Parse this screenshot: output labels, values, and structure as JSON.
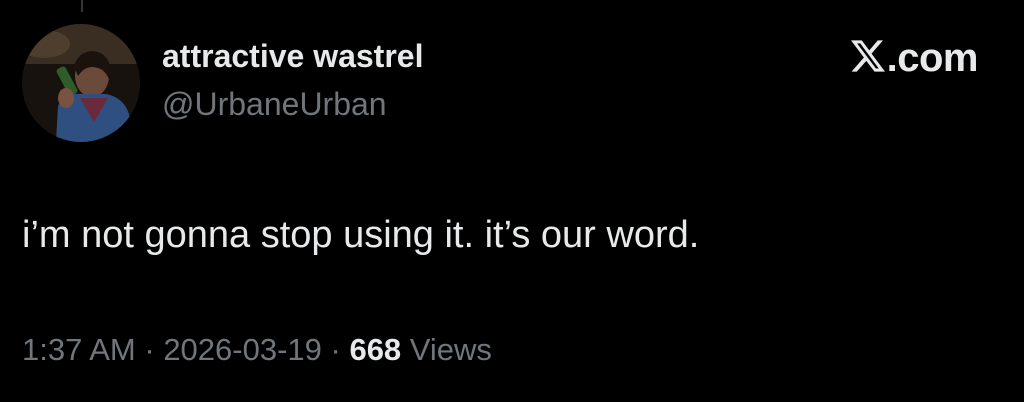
{
  "author": {
    "display_name": "attractive wastrel",
    "handle": "@UrbaneUrban",
    "avatar": "profile-photo"
  },
  "brand": {
    "icon": "x-logo-icon",
    "text": ".com"
  },
  "tweet": {
    "text": "i’m not gonna stop using it. it’s our word."
  },
  "meta": {
    "time": "1:37 AM",
    "separator": " · ",
    "date": "2026-03-19",
    "views_count": "668",
    "views_label": " Views"
  },
  "colors": {
    "background": "#000000",
    "primary_text": "#e7e9ea",
    "secondary_text": "#71767b"
  }
}
